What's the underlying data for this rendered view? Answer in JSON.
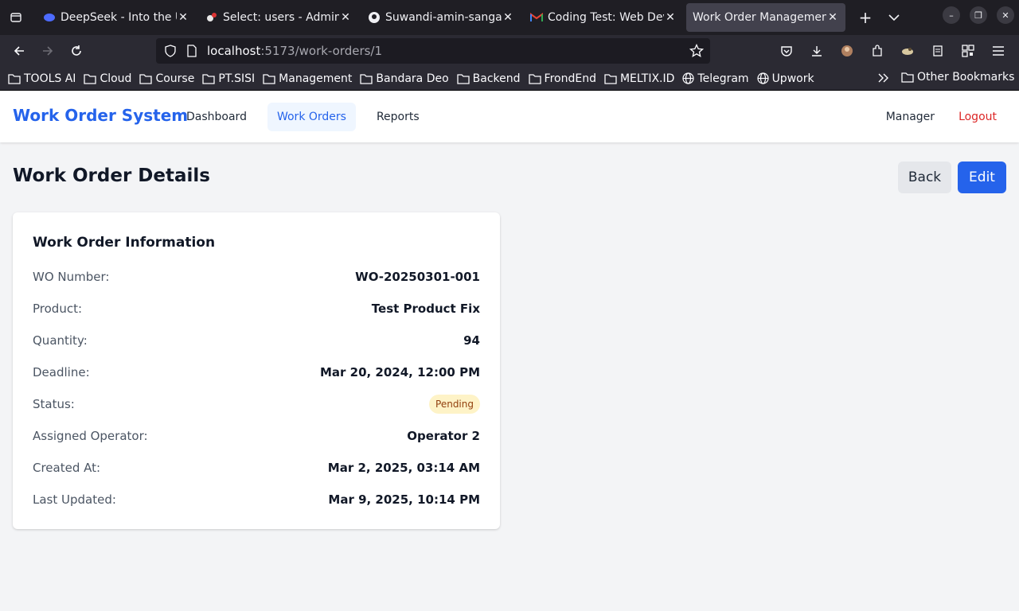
{
  "browser": {
    "tabs": [
      {
        "title": "DeepSeek - Into the Unknown",
        "icon": "deepseek-icon",
        "active": false
      },
      {
        "title": "Select: users - Adminer",
        "icon": "adminer-icon",
        "active": false
      },
      {
        "title": "Suwandi-amin-sangaji/",
        "icon": "github-icon",
        "active": false
      },
      {
        "title": "Coding Test: Web Dev",
        "icon": "gmail-icon",
        "active": false
      },
      {
        "title": "Work Order Management",
        "icon": "none",
        "active": true
      }
    ],
    "url_host": "localhost",
    "url_path": ":5173/work-orders/1",
    "bookmarks": [
      "TOOLS AI",
      "Cloud",
      "Course",
      "PT.SISI",
      "Management",
      "Bandara Deo",
      "Backend",
      "FrondEnd",
      "MELTIX.ID",
      "Telegram",
      "Upwork"
    ],
    "other_bookmarks": "Other Bookmarks"
  },
  "app": {
    "brand": "Work Order System",
    "nav": [
      {
        "label": "Dashboard",
        "active": false
      },
      {
        "label": "Work Orders",
        "active": true
      },
      {
        "label": "Reports",
        "active": false
      }
    ],
    "user_role": "Manager",
    "logout": "Logout"
  },
  "page": {
    "title": "Work Order Details",
    "back_label": "Back",
    "edit_label": "Edit"
  },
  "card": {
    "title": "Work Order Information",
    "rows": [
      {
        "label": "WO Number:",
        "value": "WO-20250301-001"
      },
      {
        "label": "Product:",
        "value": "Test Product Fix"
      },
      {
        "label": "Quantity:",
        "value": "94"
      },
      {
        "label": "Deadline:",
        "value": "Mar 20, 2024, 12:00 PM"
      },
      {
        "label": "Status:",
        "value": "Pending"
      },
      {
        "label": "Assigned Operator:",
        "value": "Operator 2"
      },
      {
        "label": "Created At:",
        "value": "Mar 2, 2025, 03:14 AM"
      },
      {
        "label": "Last Updated:",
        "value": "Mar 9, 2025, 10:14 PM"
      }
    ]
  },
  "colors": {
    "brand": "#2563eb",
    "logout": "#dc2626",
    "pending_badge_bg": "#fef3c7",
    "pending_badge_text": "#92400e"
  }
}
